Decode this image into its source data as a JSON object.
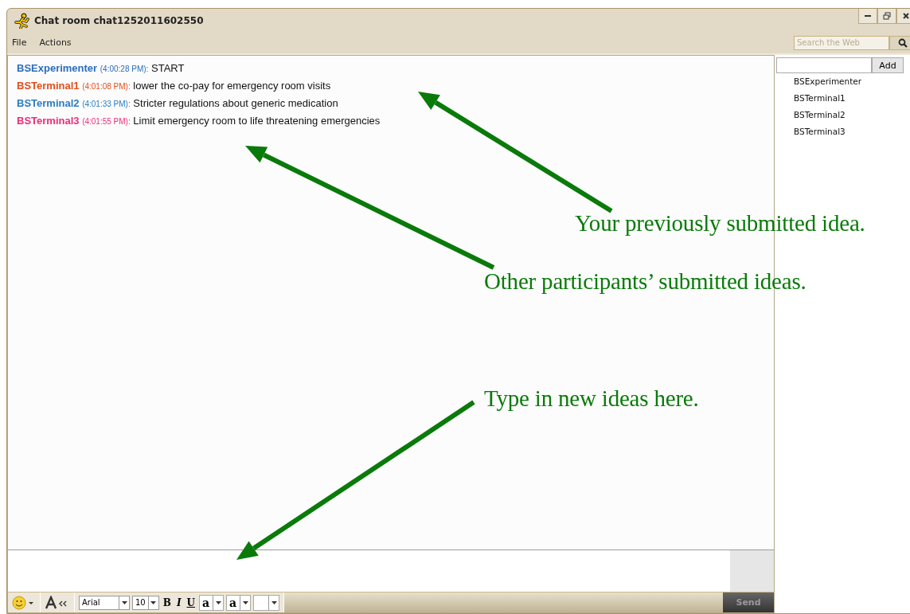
{
  "window": {
    "title": "Chat room chat1252011602550"
  },
  "menu": [
    {
      "label": "File"
    },
    {
      "label": "Actions"
    }
  ],
  "search": {
    "placeholder": "Search the Web"
  },
  "messages": [
    {
      "sender": "BSExperimenter",
      "time": "(4:00:28 PM):",
      "text": "START",
      "color": "#2a6ebb"
    },
    {
      "sender": "BSTerminal1",
      "time": "(4:01:08 PM):",
      "text": "lower the co-pay for emergency room visits",
      "color": "#e0501e"
    },
    {
      "sender": "BSTerminal2",
      "time": "(4:01:33 PM):",
      "text": "Stricter regulations about generic medication",
      "color": "#2a7cc0"
    },
    {
      "sender": "BSTerminal3",
      "time": "(4:01:55 PM):",
      "text": "Limit emergency room to life threatening emergencies",
      "color": "#ec2f7a"
    }
  ],
  "toolbar": {
    "font": "Arial",
    "size": "10",
    "style_buttons": [
      "B",
      "I",
      "U"
    ],
    "color_buttons": [
      "a",
      "a"
    ],
    "send": "Send"
  },
  "add_button": "Add",
  "participants": [
    "BSExperimenter",
    "BSTerminal1",
    "BSTerminal2",
    "BSTerminal3"
  ],
  "annotations": [
    {
      "text": "Your previously submitted idea."
    },
    {
      "text": "Other participants’ submitted ideas."
    },
    {
      "text": "Type in new ideas here."
    }
  ]
}
